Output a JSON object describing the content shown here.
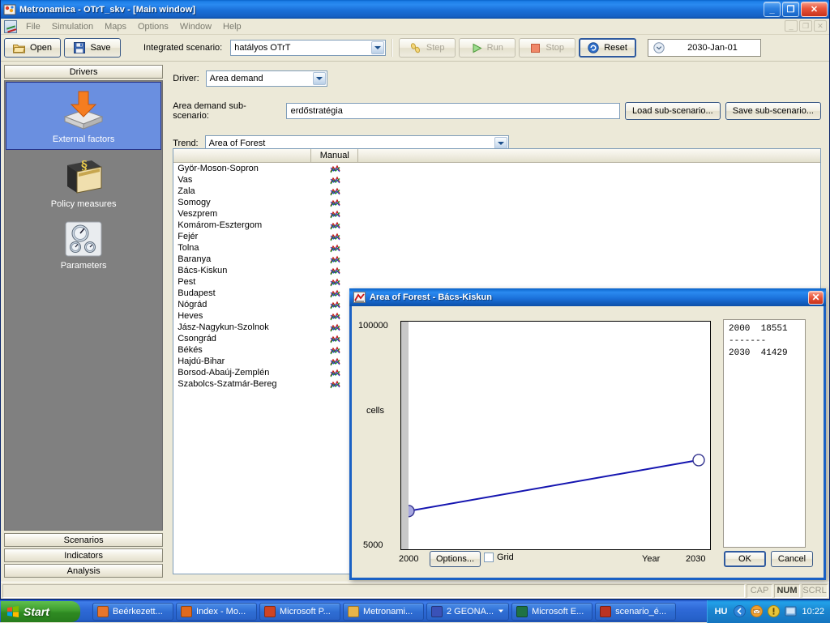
{
  "window": {
    "title": "Metronamica - OTrT_skv - [Main window]",
    "app_icon": "metronamica-icon",
    "minimize": "_",
    "maximize": "❐",
    "close": "✕",
    "mdi_minimize": "_",
    "mdi_restore": "❐",
    "mdi_close": "✕"
  },
  "menubar": {
    "items": [
      {
        "label": "File"
      },
      {
        "label": "Simulation"
      },
      {
        "label": "Maps"
      },
      {
        "label": "Options"
      },
      {
        "label": "Window"
      },
      {
        "label": "Help"
      }
    ]
  },
  "toolbar": {
    "open_label": "Open",
    "save_label": "Save",
    "scenario_label": "Integrated scenario:",
    "scenario_value": "hatályos OTrT",
    "step_label": "Step",
    "run_label": "Run",
    "stop_label": "Stop",
    "reset_label": "Reset",
    "date_value": "2030-Jan-01"
  },
  "sidebar": {
    "header": "Drivers",
    "items": [
      {
        "label": "External factors",
        "icon": "import-box-icon",
        "selected": true
      },
      {
        "label": "Policy measures",
        "icon": "law-book-icon",
        "selected": false
      },
      {
        "label": "Parameters",
        "icon": "gauges-icon",
        "selected": false
      }
    ],
    "footer": [
      {
        "label": "Scenarios"
      },
      {
        "label": "Indicators"
      },
      {
        "label": "Analysis"
      }
    ]
  },
  "main": {
    "driver_label": "Driver:",
    "driver_value": "Area demand",
    "subscenario_label": "Area demand sub-scenario:",
    "subscenario_value": "erdőstratégia",
    "load_subscenario_label": "Load sub-scenario...",
    "save_subscenario_label": "Save sub-scenario...",
    "trend_label": "Trend:",
    "trend_value": "Area of Forest",
    "grid": {
      "columns": [
        "",
        "Manual",
        ""
      ],
      "rows": [
        {
          "name": "Györ-Moson-Sopron",
          "manual": "chart-icon"
        },
        {
          "name": "Vas",
          "manual": "chart-icon"
        },
        {
          "name": "Zala",
          "manual": "chart-icon"
        },
        {
          "name": "Somogy",
          "manual": "chart-icon"
        },
        {
          "name": "Veszprem",
          "manual": "chart-icon"
        },
        {
          "name": "Komárom-Esztergom",
          "manual": "chart-icon"
        },
        {
          "name": "Fejér",
          "manual": "chart-icon"
        },
        {
          "name": "Tolna",
          "manual": "chart-icon"
        },
        {
          "name": "Baranya",
          "manual": "chart-icon"
        },
        {
          "name": "Bács-Kiskun",
          "manual": "chart-icon"
        },
        {
          "name": "Pest",
          "manual": "chart-icon"
        },
        {
          "name": "Budapest",
          "manual": "chart-icon"
        },
        {
          "name": "Nógrád",
          "manual": "chart-icon"
        },
        {
          "name": "Heves",
          "manual": "chart-icon"
        },
        {
          "name": "Jász-Nagykun-Szolnok",
          "manual": "chart-icon"
        },
        {
          "name": "Csongrád",
          "manual": "chart-icon"
        },
        {
          "name": "Békés",
          "manual": "chart-icon"
        },
        {
          "name": "Hajdú-Bihar",
          "manual": "chart-icon"
        },
        {
          "name": "Borsod-Abaúj-Zemplén",
          "manual": "chart-icon"
        },
        {
          "name": "Szabolcs-Szatmár-Bereg",
          "manual": "chart-icon"
        }
      ]
    }
  },
  "dialog": {
    "title": "Area of Forest - Bács-Kiskun",
    "close": "✕",
    "y_max_label": "100000",
    "y_min_label": "5000",
    "y_axis_label": "cells",
    "x_min_label": "2000",
    "x_max_label": "2030",
    "x_axis_label": "Year",
    "options_label": "Options...",
    "grid_label": "Grid",
    "grid_checked": false,
    "ok_label": "OK",
    "cancel_label": "Cancel",
    "value_list": "2000  18551\n-------\n2030  41429"
  },
  "chart_data": {
    "type": "line",
    "title": "Area of Forest - Bács-Kiskun",
    "xlabel": "Year",
    "ylabel": "cells",
    "xlim": [
      2000,
      2030
    ],
    "ylim": [
      5000,
      100000
    ],
    "grid": false,
    "x": [
      2000,
      2030
    ],
    "values": [
      18551,
      41429
    ],
    "series": [
      {
        "name": "Area of Forest",
        "color": "#1515b0",
        "values": [
          18551,
          41429
        ]
      }
    ],
    "markers": [
      {
        "x": 2000,
        "y": 18551,
        "state": "selected",
        "fill": "#a8a8e0"
      },
      {
        "x": 2030,
        "y": 41429,
        "state": "normal",
        "fill": "#ffffff"
      }
    ],
    "xtick_labels": [
      "2000",
      "2030"
    ],
    "ytick_labels": [
      "5000",
      "100000"
    ]
  },
  "statusbar": {
    "message": "",
    "cap": "CAP",
    "num": "NUM",
    "scrl": "SCRL"
  },
  "taskbar": {
    "start_label": "Start",
    "tasks": [
      {
        "label": "Beérkezett...",
        "icon": "mail-icon",
        "color": "#e8762c"
      },
      {
        "label": "Index - Mo...",
        "icon": "firefox-icon",
        "color": "#e06a1e"
      },
      {
        "label": "Microsoft P...",
        "icon": "powerpoint-icon",
        "color": "#d04423"
      },
      {
        "label": "Metronami...",
        "icon": "folder-icon",
        "color": "#e8b44a"
      },
      {
        "label": "2 GEONA...",
        "icon": "group-icon",
        "color": "#3a52b8",
        "group": true
      },
      {
        "label": "Microsoft E...",
        "icon": "excel-icon",
        "color": "#1f7244"
      },
      {
        "label": "scenario_é...",
        "icon": "word-icon",
        "color": "#bb3322"
      }
    ],
    "language": "HU",
    "clock": "10:22"
  }
}
